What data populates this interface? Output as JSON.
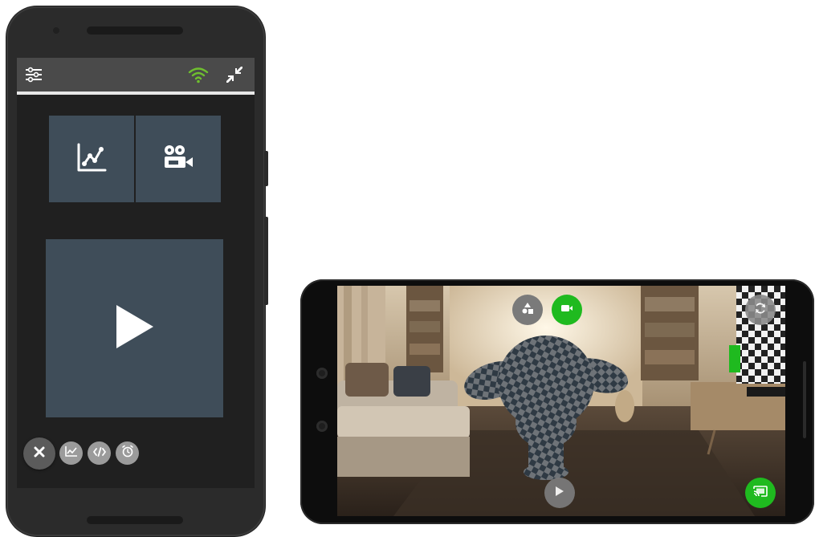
{
  "colors": {
    "accent_green": "#1fba1f",
    "wifi_green": "#6fbf2f",
    "tile_slate": "#3f4d59",
    "topbar_gray": "#4a4a4a"
  },
  "portrait_app": {
    "topbar": {
      "icons": [
        "filter-sliders-icon",
        "wifi-icon",
        "collapse-arrows-icon"
      ]
    },
    "tiles": [
      "chart-line-icon",
      "video-camera-icon"
    ],
    "main_action": "play-icon",
    "fab_row": [
      "close-icon",
      "chart-icon",
      "code-icon",
      "alarm-clock-icon"
    ]
  },
  "landscape_app": {
    "overlay_buttons": [
      "shapes-icon",
      "video-record-icon",
      "rotate-icon",
      "play-icon",
      "cast-icon"
    ]
  }
}
